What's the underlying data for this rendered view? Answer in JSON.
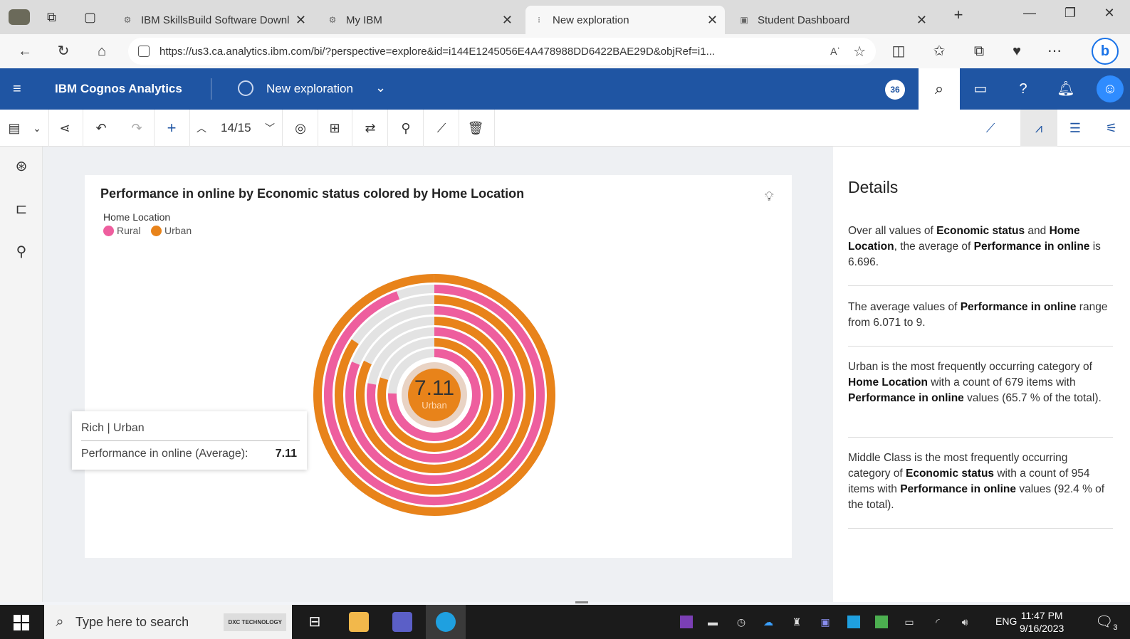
{
  "browser": {
    "tabs": [
      {
        "title": "IBM SkillsBuild Software Downlo",
        "icon": "ibm-icon",
        "active": false
      },
      {
        "title": "My IBM",
        "icon": "ibm-icon",
        "active": false
      },
      {
        "title": "New exploration",
        "icon": "loading-icon",
        "active": true
      },
      {
        "title": "Student Dashboard",
        "icon": "dashboard-icon",
        "active": false
      }
    ],
    "url": "https://us3.ca.analytics.ibm.com/bi/?perspective=explore&id=i144E1245056E4A478988DD6422BAE29D&objRef=i1...",
    "read_aloud": "Aʾ"
  },
  "app": {
    "brand": "IBM Cognos Analytics",
    "exploration_title": "New exploration",
    "badge": "36"
  },
  "toolbar": {
    "page_indicator": "14/15"
  },
  "chart": {
    "title": "Performance in online by Economic status colored by Home Location",
    "legend_title": "Home Location",
    "center_value": "7.11",
    "center_label": "Urban"
  },
  "chart_data": {
    "type": "radial-bar",
    "title": "Performance in online by Economic status colored by Home Location",
    "legend": [
      "Rural",
      "Urban"
    ],
    "legend_title": "Home Location",
    "colors": {
      "Rural": "#ee5e9e",
      "Urban": "#e8831a"
    },
    "series": [
      {
        "name": "Urban",
        "values": [
          9.0,
          7.6,
          7.4,
          7.2,
          7.11
        ]
      },
      {
        "name": "Rural",
        "values": [
          8.5,
          7.3,
          7.0,
          6.8,
          6.071
        ]
      }
    ],
    "max": 9
  },
  "tooltip": {
    "header": "Rich | Urban",
    "measure_label": "Performance in online (Average):",
    "measure_value": "7.11"
  },
  "details": {
    "title": "Details",
    "insights": [
      [
        "Over all values of ",
        "Economic status",
        " and ",
        "Home Location",
        ", the average of ",
        "Performance in online",
        " is 6.696."
      ],
      [
        "The average values of ",
        "Performance in online",
        " range from 6.071 to 9."
      ],
      [
        "Urban is the most frequently occurring category of ",
        "Home Location",
        " with a count of 679 items with ",
        "Performance in online",
        " values (65.7 % of the total)."
      ],
      [
        "Middle Class is the most frequently occurring category of ",
        "Economic status",
        " with a count of 954 items with ",
        "Performance in online",
        " values (92.4 % of the total)."
      ]
    ]
  },
  "taskbar": {
    "search_placeholder": "Type here to search",
    "search_brand": "DXC TECHNOLOGY",
    "language": "ENG",
    "time": "11:47 PM",
    "date": "9/16/2023",
    "notifications": "3"
  }
}
